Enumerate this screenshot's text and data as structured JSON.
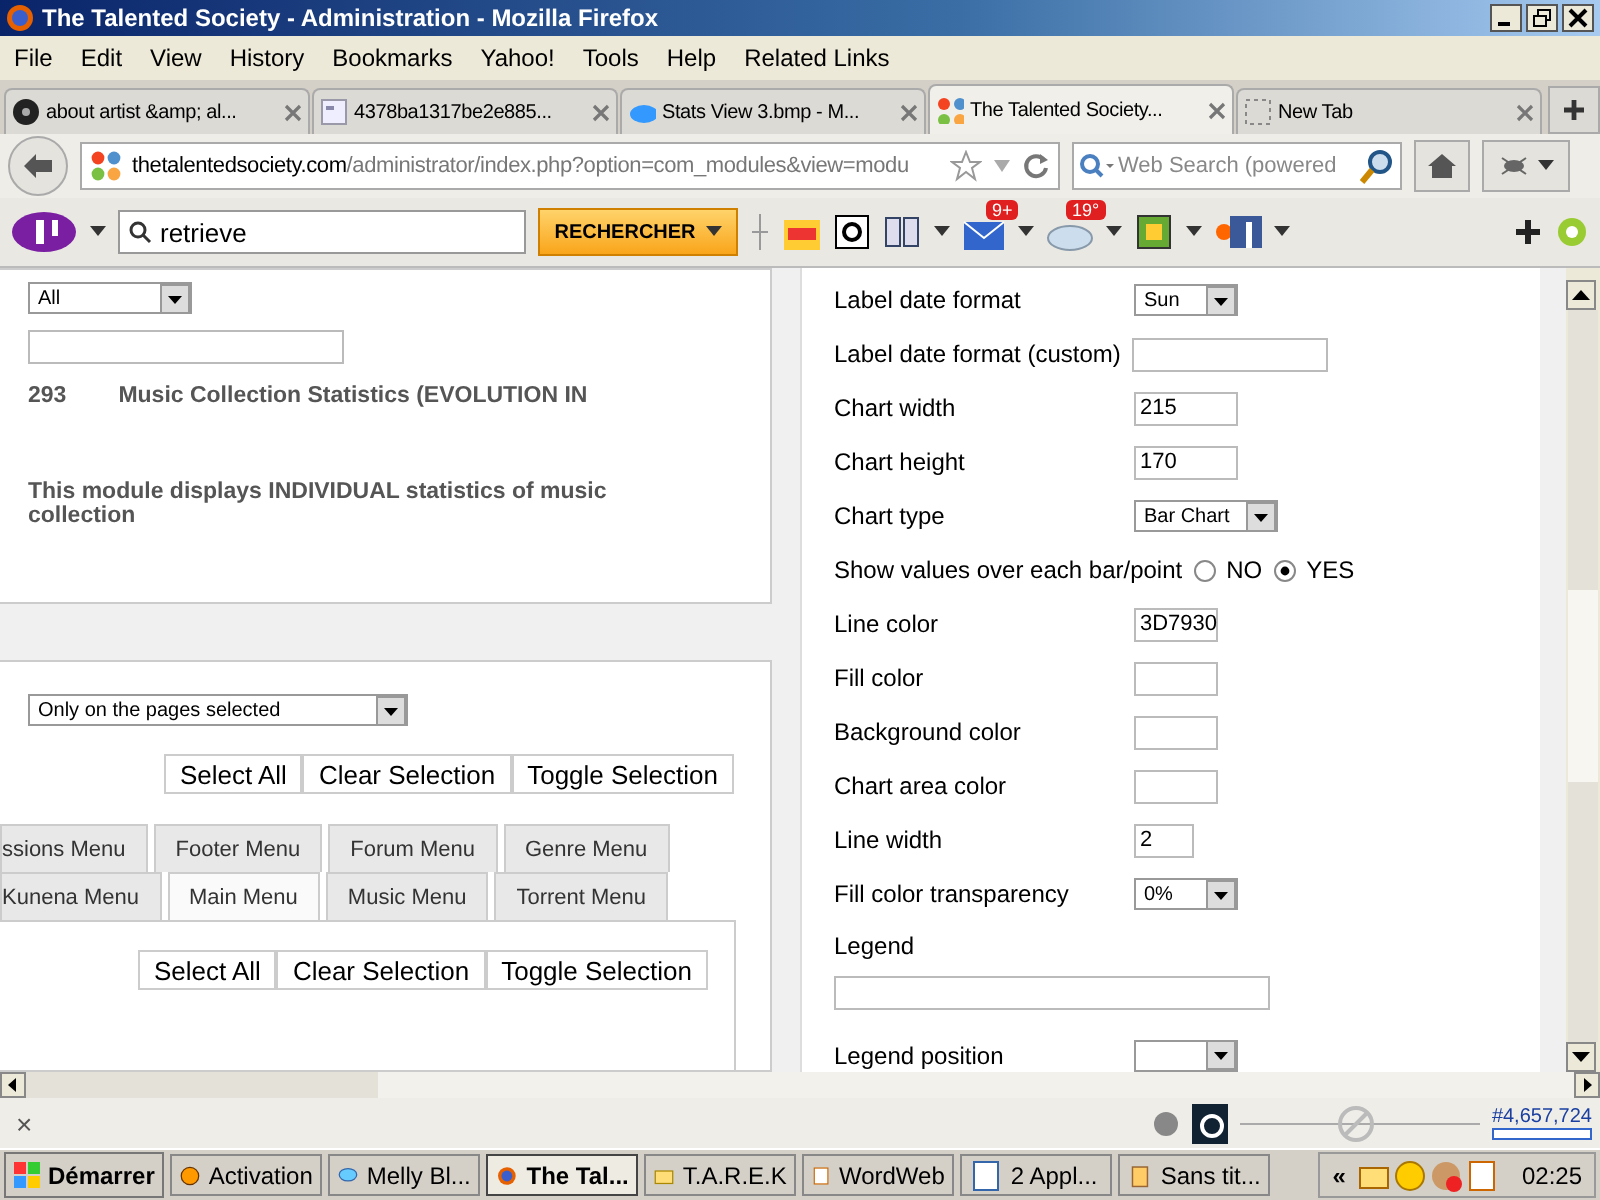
{
  "window": {
    "title": "The Talented Society - Administration - Mozilla Firefox"
  },
  "menu_bar": [
    "File",
    "Edit",
    "View",
    "History",
    "Bookmarks",
    "Yahoo!",
    "Tools",
    "Help",
    "Related Links"
  ],
  "tabs": [
    {
      "label": "about artist &amp; al...",
      "selected": false
    },
    {
      "label": "4378ba1317be2e885...",
      "selected": false
    },
    {
      "label": "Stats View 3.bmp - M...",
      "selected": false
    },
    {
      "label": "The Talented Society...",
      "selected": true
    },
    {
      "label": "New Tab",
      "selected": false
    }
  ],
  "address_bar": {
    "domain": "thetalentedsociety.com",
    "path": "/administrator/index.php?option=com_modules&view=modu"
  },
  "web_search": {
    "placeholder": "Web Search (powered"
  },
  "yahoo_toolbar": {
    "search_value": "retrieve",
    "search_button": "RECHERCHER",
    "mail_badge": "9+",
    "weather_badge": "19°"
  },
  "module_panel": {
    "filter_select": "All",
    "module_id": "293",
    "module_title": "Music Collection Statistics (EVOLUTION IN",
    "description": "This module displays INDIVIDUAL statistics of music collection"
  },
  "assignment_panel": {
    "assignment_select": "Only on the pages selected",
    "buttons": [
      "Select All",
      "Clear Selection",
      "Toggle Selection"
    ],
    "menu_tab_rows": [
      [
        {
          "label": "ssions Menu",
          "selected": false
        },
        {
          "label": "Footer Menu",
          "selected": false
        },
        {
          "label": "Forum Menu",
          "selected": false
        },
        {
          "label": "Genre Menu",
          "selected": false
        }
      ],
      [
        {
          "label": "Kunena Menu",
          "selected": false
        },
        {
          "label": "Main Menu",
          "selected": true
        },
        {
          "label": "Music Menu",
          "selected": false
        },
        {
          "label": "Torrent Menu",
          "selected": false
        }
      ]
    ],
    "tab_buttons": [
      "Select All",
      "Clear Selection",
      "Toggle Selection"
    ]
  },
  "settings": [
    {
      "kind": "select",
      "label": "Label date format",
      "value": "Sun"
    },
    {
      "kind": "text",
      "label": "Label date format (custom)"
    },
    {
      "kind": "number",
      "label": "Chart width",
      "value": "215"
    },
    {
      "kind": "number",
      "label": "Chart height",
      "value": "170"
    },
    {
      "kind": "select",
      "label": "Chart type",
      "value": "Bar Chart"
    },
    {
      "kind": "radio",
      "label": "Show values over each bar/point",
      "options": [
        {
          "label": "NO",
          "selected": false
        },
        {
          "label": "YES",
          "selected": true
        }
      ]
    },
    {
      "kind": "color",
      "label": "Line color",
      "value": "3D7930"
    },
    {
      "kind": "color",
      "label": "Fill color"
    },
    {
      "kind": "color",
      "label": "Background color"
    },
    {
      "kind": "color",
      "label": "Chart area color"
    },
    {
      "kind": "small",
      "label": "Line width",
      "value": "2"
    },
    {
      "kind": "select",
      "label": "Fill color transparency",
      "value": "0%"
    },
    {
      "kind": "wide",
      "label": "Legend"
    },
    {
      "kind": "select",
      "label": "Legend position"
    }
  ],
  "status_bar": {
    "close": "×",
    "counter": "#4,657,724"
  },
  "taskbar": {
    "start": "Démarrer",
    "items": [
      {
        "label": "Activation",
        "selected": false
      },
      {
        "label": "Melly Bl...",
        "selected": false
      },
      {
        "label": "The Tal...",
        "selected": true
      },
      {
        "label": "T.A.R.E.K",
        "selected": false
      },
      {
        "label": "WordWeb",
        "selected": false
      },
      {
        "label": "2 Appl...",
        "selected": false
      },
      {
        "label": "Sans tit...",
        "selected": false
      }
    ],
    "tray_toggle": "«",
    "clock": "02:25"
  }
}
